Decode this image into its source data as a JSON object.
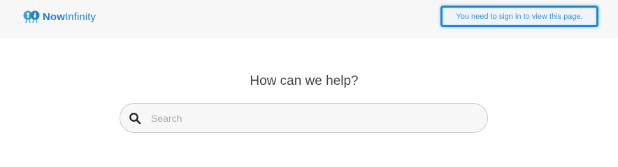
{
  "header": {
    "logo": {
      "text_now": "Now",
      "text_infinity": "Infinity",
      "icon": "nowinfinity-logo-icon"
    },
    "signin_notice": "You need to sign in to view this page."
  },
  "main": {
    "title": "How can we help?",
    "search": {
      "placeholder": "Search",
      "value": "",
      "icon": "search-icon"
    }
  },
  "colors": {
    "header_bg": "#f7f7f7",
    "brand_blue": "#2a7fc4",
    "notice_border": "#1e88d6",
    "notice_text": "#3b8fcc"
  }
}
